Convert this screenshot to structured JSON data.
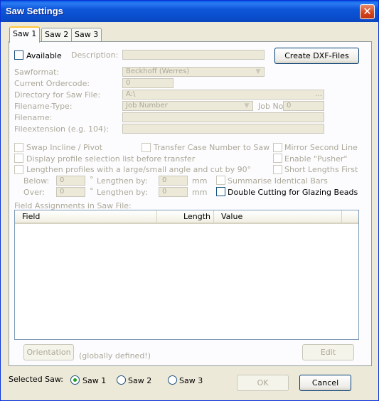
{
  "window": {
    "title": "Saw Settings",
    "close_glyph": "✕"
  },
  "tabs": [
    {
      "label": "Saw 1",
      "active": true
    },
    {
      "label": "Saw 2",
      "active": false
    },
    {
      "label": "Saw 3",
      "active": false
    }
  ],
  "general": {
    "available_label": "Available",
    "available_checked": false,
    "description_label": "Description:",
    "description_value": "",
    "create_dxf_label": "Create DXF-Files"
  },
  "settings": {
    "sawformat_label": "Sawformat:",
    "sawformat_value": "Beckhoff (Werres)",
    "ordercode_label": "Current Ordercode:",
    "ordercode_value": "0",
    "directory_label": "Directory for Saw File:",
    "directory_value": "A:\\",
    "browse_glyph": "…",
    "filename_type_label": "Filename-Type:",
    "filename_type_value": "Job Number",
    "jobno_label": "Job No",
    "jobno_value": "0",
    "filename_label": "Filename:",
    "filename_value": "",
    "fileext_label": "Fileextension (e.g. 104):",
    "fileext_value": ""
  },
  "options": {
    "swap_incline": "Swap Incline / Pivot",
    "transfer_case": "Transfer Case Number to Saw",
    "mirror_second": "Mirror Second Line",
    "display_profile": "Display profile selection list before transfer",
    "enable_pusher": "Enable \"Pusher\"",
    "lengthen_profiles": "Lengthen profiles with a large/small angle and cut by 90°",
    "short_lengths": "Short Lengths First",
    "below_label": "Below:",
    "below_value": "0",
    "over_label": "Over:",
    "over_value": "0",
    "degree_unit": "°",
    "lengthen_by_label": "Lengthen by:",
    "lengthen_below_value": "0",
    "lengthen_over_value": "0",
    "mm_unit": "mm",
    "summarise_bars": "Summarise Identical Bars",
    "double_cutting": "Double Cutting for Glazing Beads"
  },
  "assignments": {
    "label": "Field Assignments in Saw File:",
    "columns": [
      "Field",
      "Length",
      "Value"
    ],
    "rows": []
  },
  "panel_buttons": {
    "orientation": "Orientation",
    "orientation_note": "(globally defined!)",
    "edit": "Edit"
  },
  "footer": {
    "selected_saw_label": "Selected Saw:",
    "saws": [
      "Saw 1",
      "Saw 2",
      "Saw 3"
    ],
    "selected": "Saw 1",
    "ok_label": "OK",
    "cancel_label": "Cancel"
  },
  "colors": {
    "titlebar": "#0a4fd0",
    "dialog_bg": "#ece9d8",
    "disabled_text": "#aca899",
    "tab_highlight": "#ffc83c",
    "radio_selected": "#21a121"
  }
}
